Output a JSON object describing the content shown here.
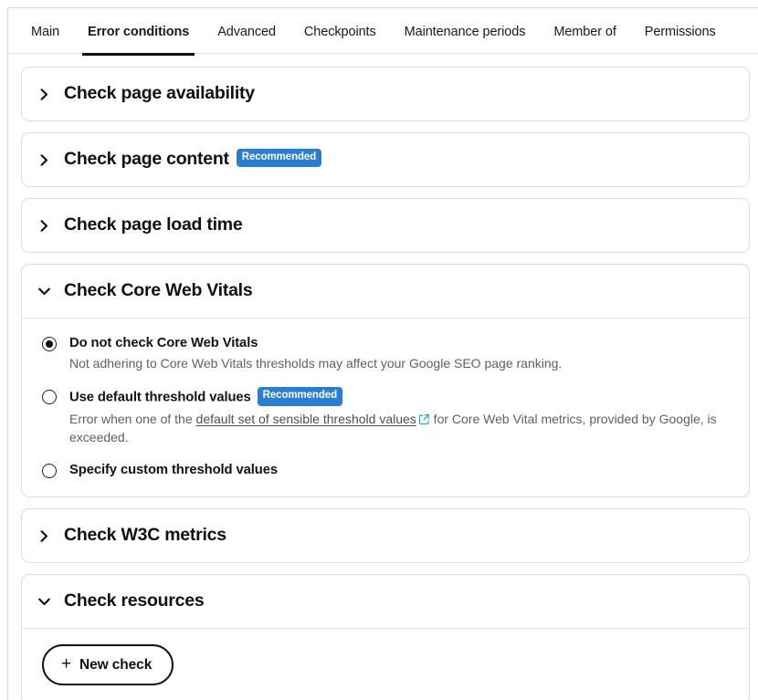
{
  "tabs": [
    {
      "label": "Main",
      "active": false
    },
    {
      "label": "Error conditions",
      "active": true
    },
    {
      "label": "Advanced",
      "active": false
    },
    {
      "label": "Checkpoints",
      "active": false
    },
    {
      "label": "Maintenance periods",
      "active": false
    },
    {
      "label": "Member of",
      "active": false
    },
    {
      "label": "Permissions",
      "active": false
    }
  ],
  "colors": {
    "badge_blue": "#2b7cd3",
    "active_tab_underline": "#111111",
    "external_link_icon": "#2aa8b8",
    "card_border": "#dcdcdc",
    "description_text": "#5c6166"
  },
  "sections": [
    {
      "id": "page-availability",
      "title": "Check page availability",
      "expanded": false,
      "badge": null
    },
    {
      "id": "page-content",
      "title": "Check page content",
      "expanded": false,
      "badge": "Recommended"
    },
    {
      "id": "page-load-time",
      "title": "Check page load time",
      "expanded": false,
      "badge": null
    },
    {
      "id": "core-web-vitals",
      "title": "Check Core Web Vitals",
      "expanded": true,
      "badge": null
    },
    {
      "id": "w3c-metrics",
      "title": "Check W3C metrics",
      "expanded": false,
      "badge": null
    },
    {
      "id": "resources",
      "title": "Check resources",
      "expanded": true,
      "badge": null
    }
  ],
  "core_web_vitals": {
    "options": [
      {
        "label": "Do not check Core Web Vitals",
        "selected": true,
        "badge": null,
        "description": "Not adhering to Core Web Vitals thresholds may affect your Google SEO page ranking.",
        "desc_parts": null
      },
      {
        "label": "Use default threshold values",
        "selected": false,
        "badge": "Recommended",
        "description": null,
        "desc_parts": {
          "before": "Error when one of the ",
          "link": "default set of sensible threshold values",
          "after": " for Core Web Vital metrics, provided by Google, is exceeded."
        }
      },
      {
        "label": "Specify custom threshold values",
        "selected": false,
        "badge": null,
        "description": null,
        "desc_parts": null
      }
    ]
  },
  "resources": {
    "new_check_label": "New check",
    "plus_glyph": "+"
  },
  "icons": {
    "chevron_collapsed": "chevron-right-icon",
    "chevron_expanded": "chevron-down-icon",
    "external_link": "external-link-icon",
    "plus": "plus-icon"
  }
}
